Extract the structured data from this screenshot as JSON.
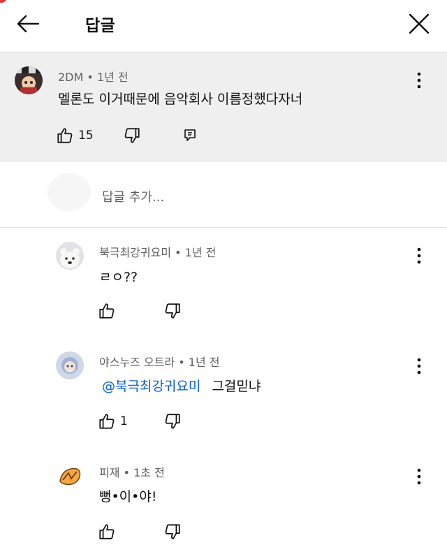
{
  "header": {
    "title": "답글"
  },
  "parent_comment": {
    "author": "2DM",
    "time": "1년 전",
    "text": "멜론도 이거때문에 음악회사 이름정했다자너",
    "likes": "15"
  },
  "add_reply": {
    "placeholder": "답글 추가..."
  },
  "replies": [
    {
      "author": "북극최강귀요미",
      "time": "1년 전",
      "text": "ㄹㅇ??",
      "likes": ""
    },
    {
      "author": "야스누즈 오트라",
      "time": "1년 전",
      "mention": "@북극최강귀요미",
      "text": "그걸믿냐",
      "likes": "1"
    },
    {
      "author": "피재",
      "time": "1초 전",
      "text": "뻥•이•야!",
      "likes": ""
    }
  ],
  "separator": "•",
  "icons": [
    "back-arrow-icon",
    "close-icon",
    "thumbs-up-icon",
    "thumbs-down-icon",
    "reply-icon",
    "more-vert-icon"
  ],
  "colors": {
    "background": "#ffffff",
    "parent_bg": "#efefef",
    "text": "#0f0f0f",
    "meta": "#606060",
    "mention": "#065fd4"
  }
}
